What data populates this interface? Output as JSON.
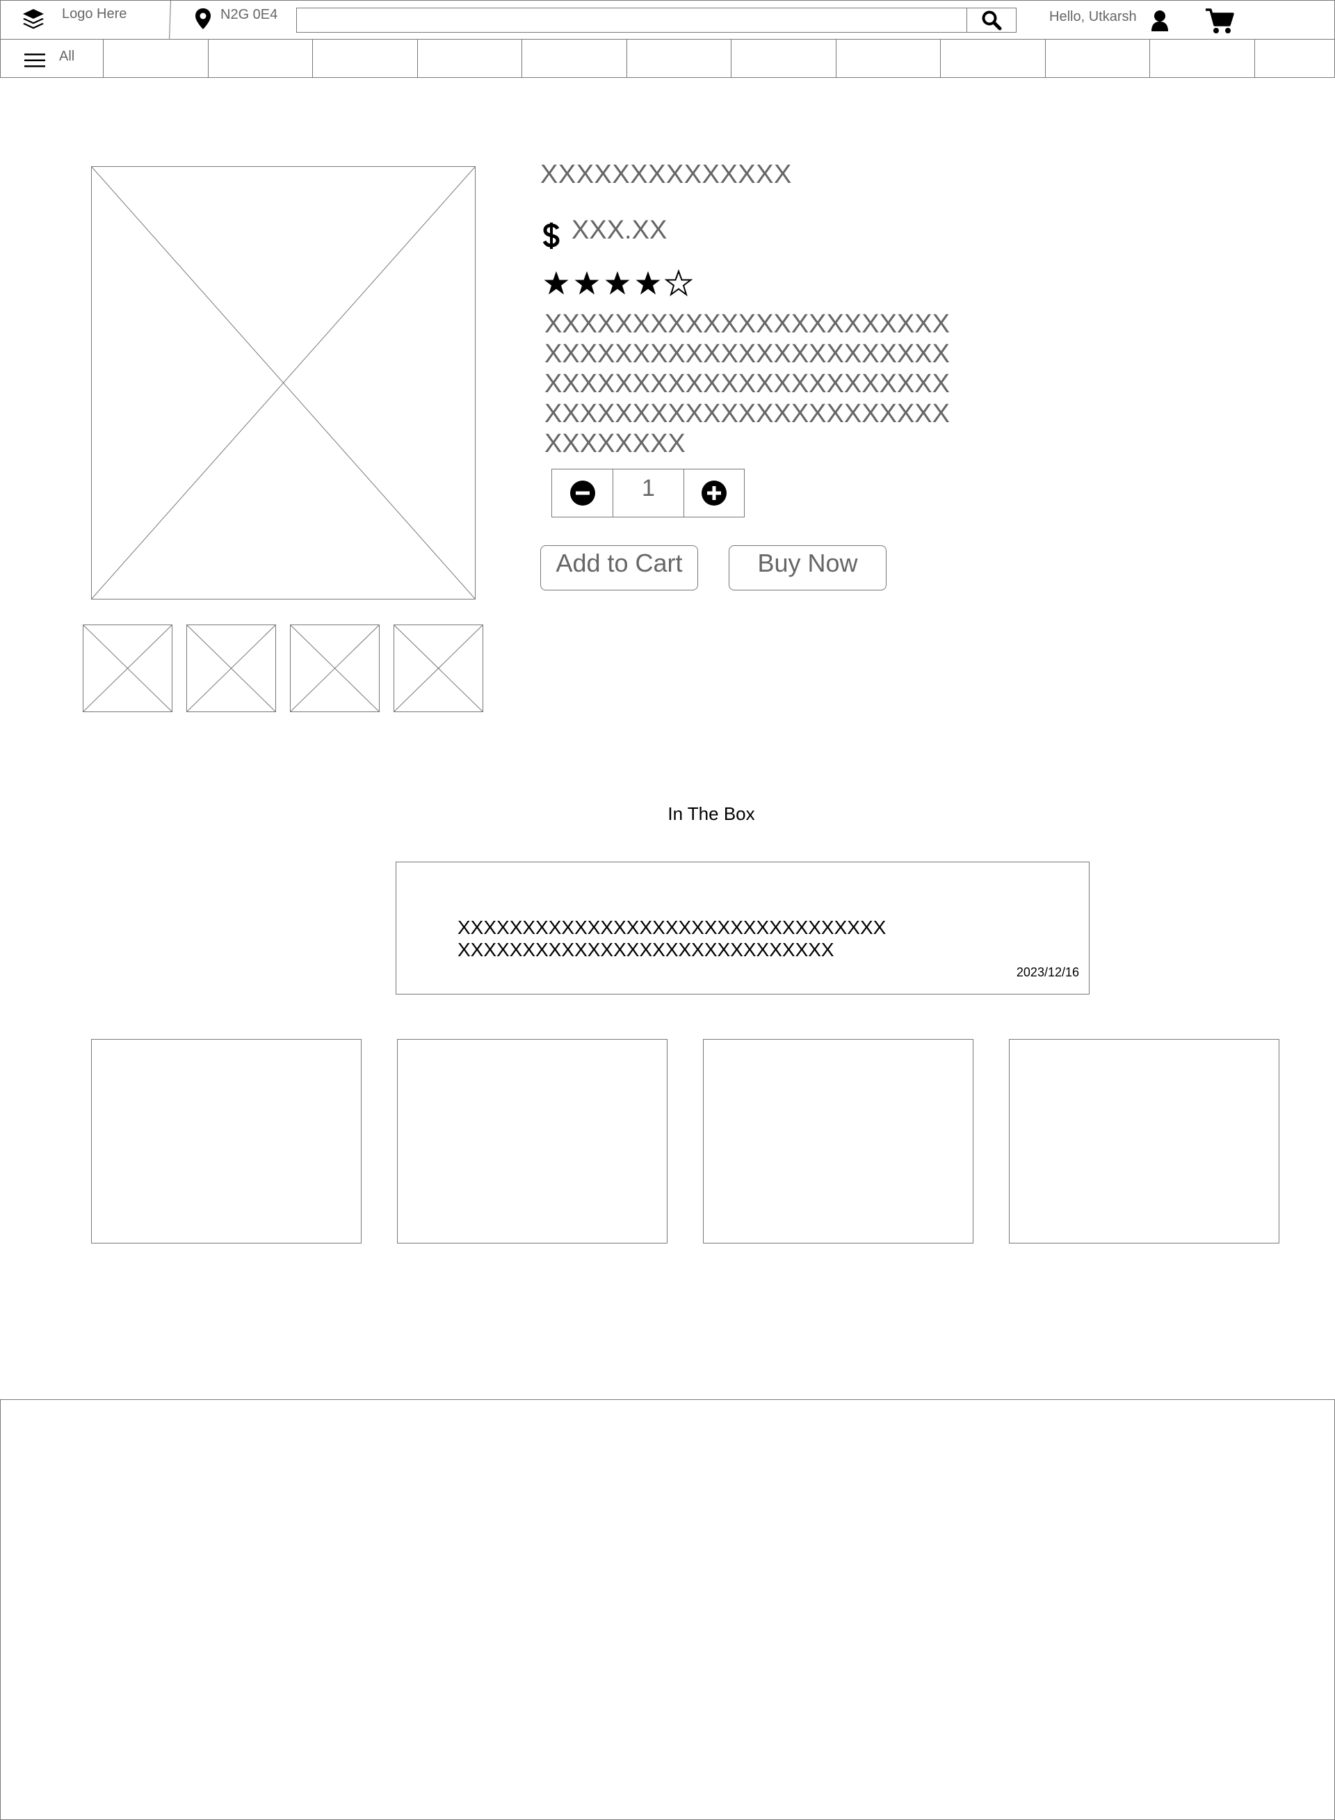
{
  "header": {
    "logo_label": "Logo Here",
    "location_label": "N2G 0E4",
    "search": {
      "value": "",
      "placeholder": ""
    },
    "greeting": "Hello, Utkarsh",
    "icons": {
      "logo": "layers-icon",
      "location": "map-pin-icon",
      "search": "search-icon",
      "user": "user-icon",
      "cart": "cart-icon"
    }
  },
  "nav": {
    "menu_label": "All",
    "menu_icon": "hamburger-icon",
    "items": [
      "",
      "",
      "",
      "",
      "",
      "",
      "",
      "",
      "",
      "",
      "",
      ""
    ]
  },
  "product": {
    "title": "XXXXXXXXXXXXXX",
    "currency_icon": "dollar-icon",
    "price": "XXX.XX",
    "rating": {
      "value": 4.5,
      "max": 5
    },
    "description_lines": [
      "XXXXXXXXXXXXXXXXXXXXXXX",
      "XXXXXXXXXXXXXXXXXXXXXXX",
      "XXXXXXXXXXXXXXXXXXXXXXX",
      "XXXXXXXXXXXXXXXXXXXXXXX",
      "XXXXXXXX"
    ],
    "quantity": "1",
    "add_to_cart_label": "Add to Cart",
    "buy_now_label": "Buy Now"
  },
  "in_the_box": {
    "heading": "In The Box",
    "lines": [
      "XXXXXXXXXXXXXXXXXXXXXXXXXXXXXXXXX",
      "XXXXXXXXXXXXXXXXXXXXXXXXXXXXX"
    ],
    "date": "2023/12/16"
  }
}
